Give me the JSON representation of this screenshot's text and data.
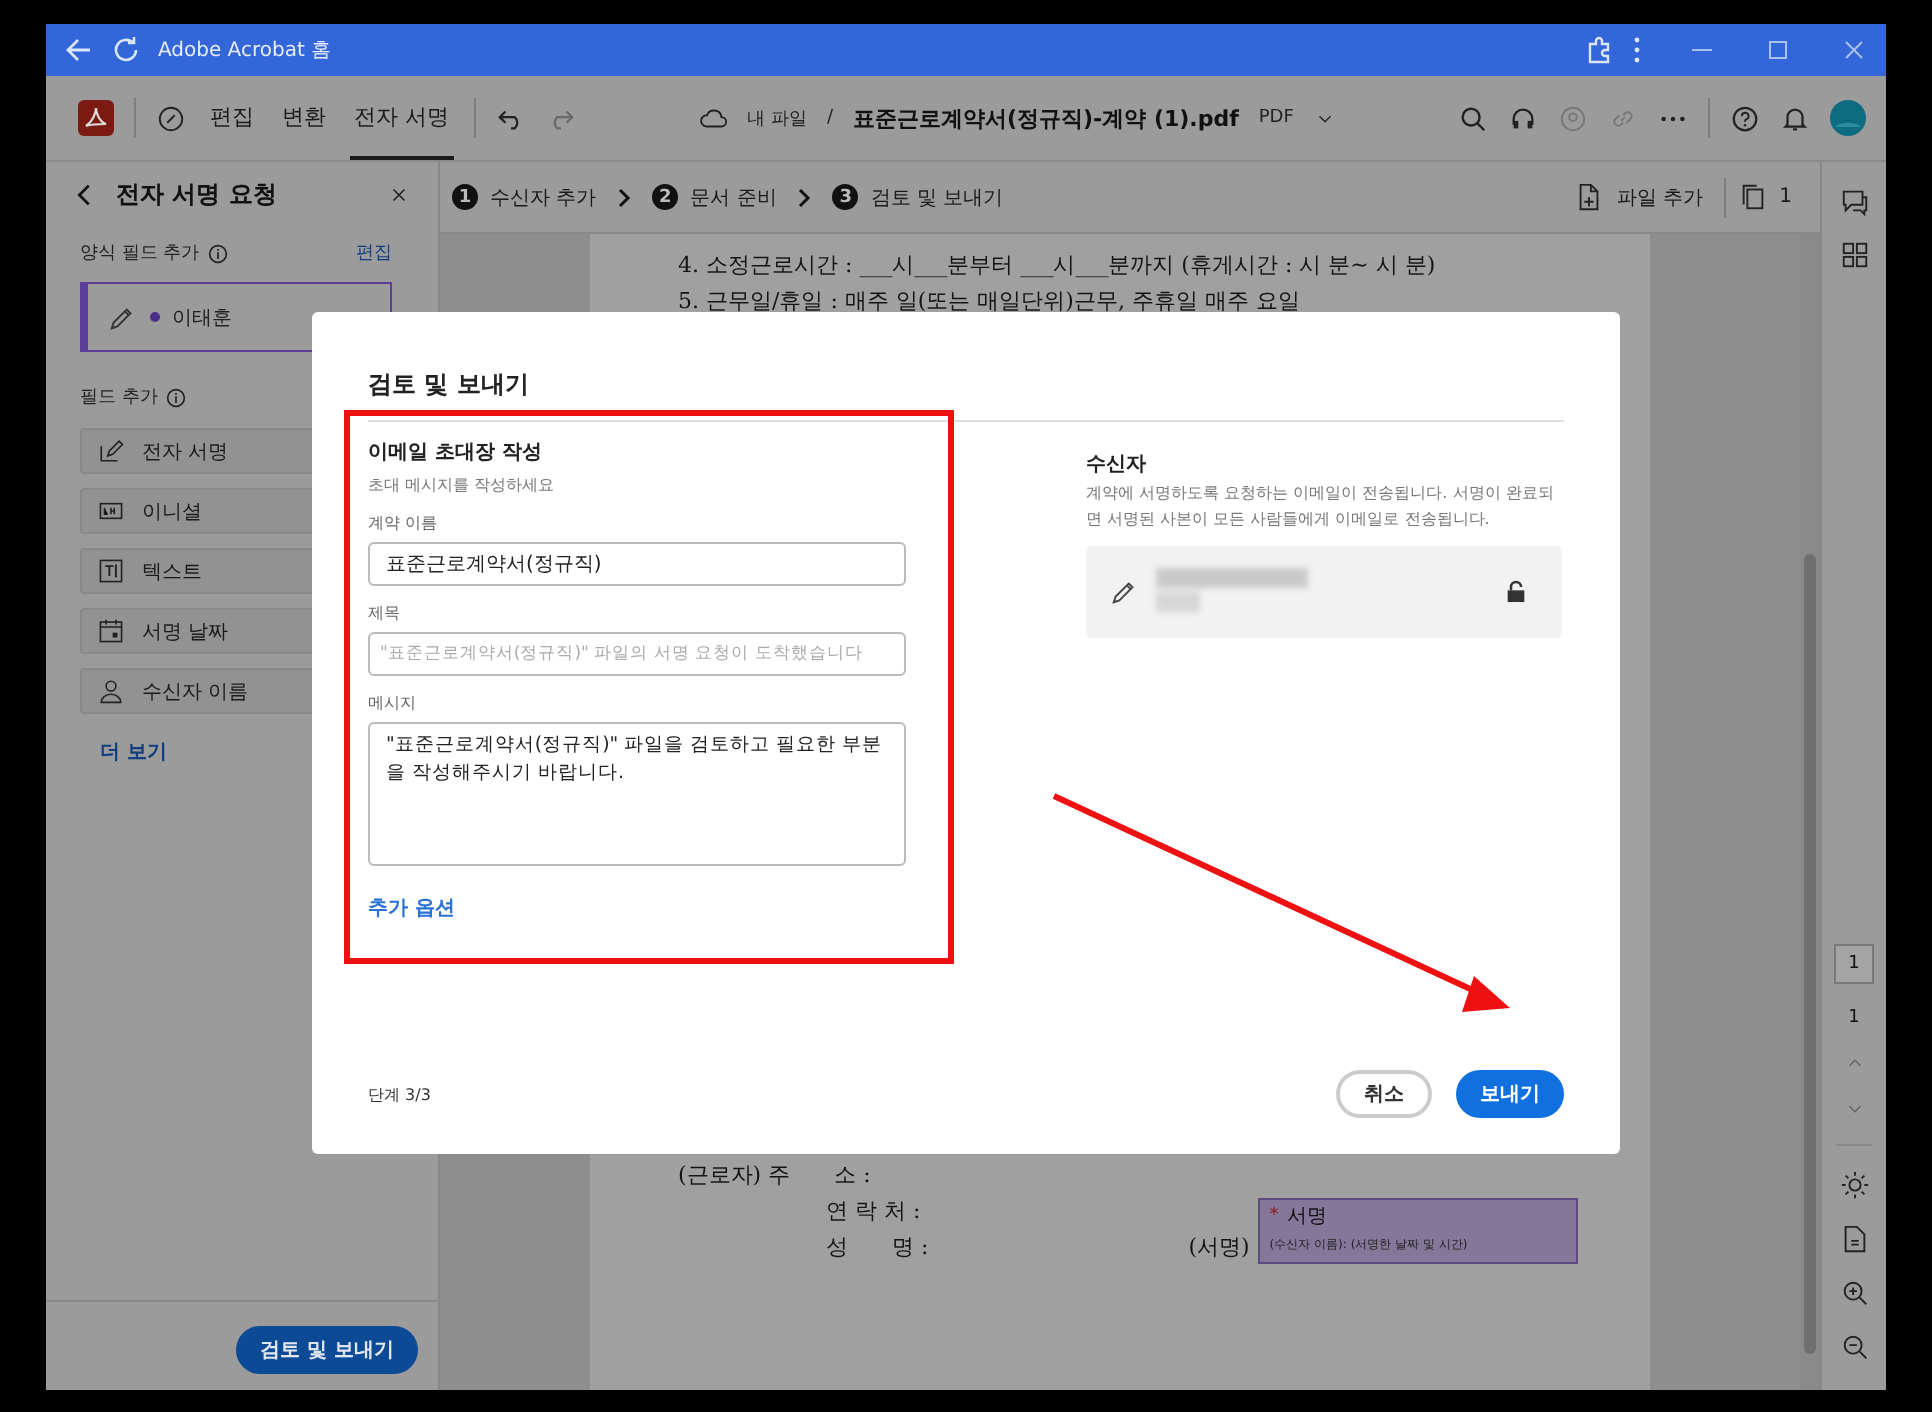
{
  "window": {
    "title": "Adobe Acrobat 홈"
  },
  "toolbar": {
    "tabs": [
      {
        "label": "편집",
        "selected": false
      },
      {
        "label": "변환",
        "selected": false
      },
      {
        "label": "전자 서명",
        "selected": true
      }
    ],
    "breadcrumb": "내 파일",
    "separator": "/",
    "file_name": "표준근로계약서(정규직)-계약 (1).pdf",
    "file_type": "PDF"
  },
  "sidebar": {
    "title": "전자 서명 요청",
    "template_label": "양식 필드 추가",
    "edit_link": "편집",
    "signer": "이태훈",
    "fields_label": "필드 추가",
    "fields": [
      {
        "kind": "signature",
        "label": "전자 서명"
      },
      {
        "kind": "initials",
        "label": "이니셜"
      },
      {
        "kind": "text",
        "label": "텍스트"
      },
      {
        "kind": "date",
        "label": "서명 날짜"
      },
      {
        "kind": "name",
        "label": "수신자 이름"
      }
    ],
    "more_link": "더 보기",
    "primary_button": "검토 및 보내기"
  },
  "steps": [
    {
      "number": "1",
      "label": "수신자 추가"
    },
    {
      "number": "2",
      "label": "문서 준비"
    },
    {
      "number": "3",
      "label": "검토 및 보내기"
    }
  ],
  "step_actions": {
    "add_file": "파일 추가",
    "page_count": "1"
  },
  "document": {
    "top_lines": [
      "4. 소정근로시간 : ___시___분부터 ___시___분까지 (휴게시간 :  시  분~  시  분)",
      "5. 근무일/휴일 : 매주    일(또는 매일단위)근무, 주휴일 매주    요일"
    ],
    "worker_rows": [
      {
        "label": "(근로자) 주　　소 :"
      },
      {
        "label": "연 락 처 :"
      },
      {
        "label": "성　　명 :"
      }
    ],
    "sign_label": "(서명)",
    "signature_field": {
      "required_mark": "*",
      "title": "서명",
      "caption": "(수신자 이름): (서명한 날짜 및 시간)"
    }
  },
  "right_rail": {
    "page_input": "1",
    "page_total": "1"
  },
  "dialog": {
    "title": "검토 및 보내기",
    "section_title": "이메일 초대장 작성",
    "section_hint": "초대 메시지를 작성하세요",
    "contract_name": {
      "label": "계약 이름",
      "value": "표준근로계약서(정규직)"
    },
    "subject": {
      "label": "제목",
      "placeholder": "\"표준근로계약서(정규직)\" 파일의 서명 요청이 도착했습니다"
    },
    "message": {
      "label": "메시지",
      "value": "\"표준근로계약서(정규직)\" 파일을 검토하고 필요한 부분을 작성해주시기 바랍니다."
    },
    "more_options": "추가 옵션",
    "recipients_title": "수신자",
    "recipients_text": "계약에 서명하도록 요청하는 이메일이 전송됩니다. 서명이 완료되면 서명된 사본이 모든 사람들에게 이메일로 전송됩니다.",
    "step": "단계 3/3",
    "cancel": "취소",
    "send": "보내기"
  }
}
